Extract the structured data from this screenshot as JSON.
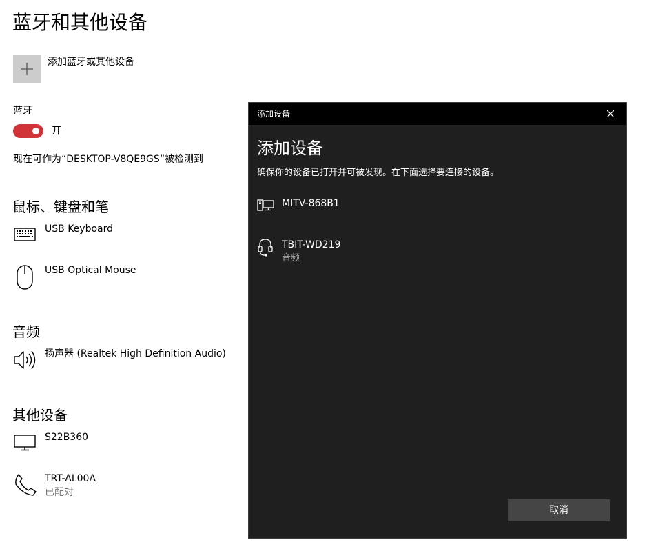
{
  "page": {
    "title": "蓝牙和其他设备",
    "add_device_label": "添加蓝牙或其他设备"
  },
  "bluetooth": {
    "label": "蓝牙",
    "state_label": "开",
    "on": true,
    "discoverable_text": "现在可作为“DESKTOP-V8QE9GS”被检测到",
    "accent_color": "#d13438"
  },
  "sections": {
    "input": {
      "title": "鼠标、键盘和笔",
      "devices": [
        {
          "name": "USB Keyboard",
          "icon": "keyboard-icon"
        },
        {
          "name": "USB Optical Mouse",
          "icon": "mouse-icon"
        }
      ]
    },
    "audio": {
      "title": "音频",
      "devices": [
        {
          "name": "扬声器 (Realtek High Definition Audio)",
          "icon": "speaker-icon"
        }
      ]
    },
    "other": {
      "title": "其他设备",
      "devices": [
        {
          "name": "S22B360",
          "icon": "monitor-icon"
        },
        {
          "name": "TRT-AL00A",
          "status": "已配对",
          "icon": "phone-icon"
        }
      ]
    }
  },
  "dialog": {
    "window_title": "添加设备",
    "heading": "添加设备",
    "description": "确保你的设备已打开并可被发现。在下面选择要连接的设备。",
    "devices": [
      {
        "name": "MITV-868B1",
        "icon": "computer-icon"
      },
      {
        "name": "TBIT-WD219",
        "type": "音频",
        "icon": "headset-icon"
      }
    ],
    "cancel_label": "取消"
  }
}
